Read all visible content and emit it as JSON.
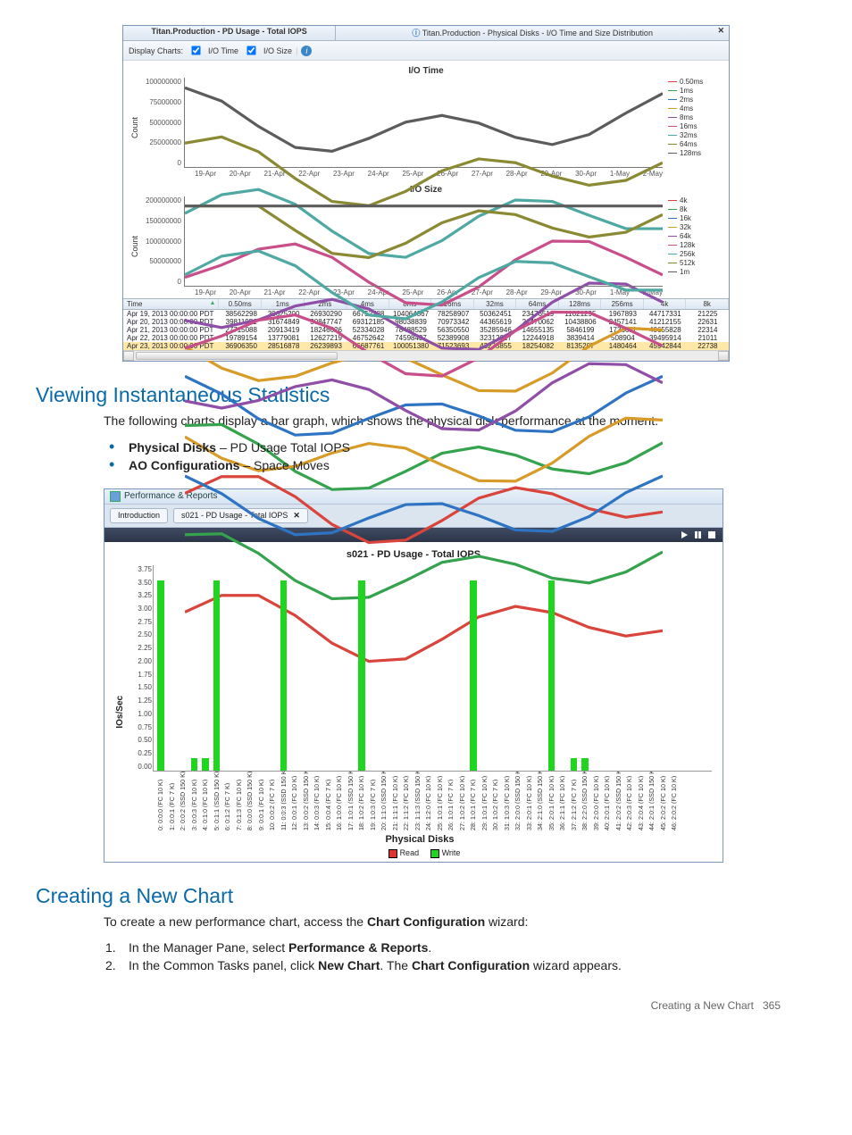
{
  "section1": {
    "heading": "Viewing Instantaneous Statistics",
    "intro": "The following charts display a bar graph, which shows the physical disk performance at the moment:",
    "bullets": [
      {
        "bold": "Physical Disks",
        "rest": " – PD Usage Total IOPS"
      },
      {
        "bold": "AO Configurations",
        "rest": " – Space Moves"
      }
    ]
  },
  "section2": {
    "heading": "Creating a New Chart",
    "intro_pre": "To create a new performance chart, access the ",
    "intro_bold": "Chart Configuration",
    "intro_post": " wizard:",
    "steps": [
      {
        "pre": "In the Manager Pane, select ",
        "b1": "Performance & Reports",
        "post1": ".",
        "b2": "",
        "post2": ""
      },
      {
        "pre": "In the Common Tasks panel, click ",
        "b1": "New Chart",
        "post1": ". The ",
        "b2": "Chart Configuration",
        "post2": " wizard appears."
      }
    ]
  },
  "app1": {
    "title_left": "Titan.Production - PD Usage - Total IOPS",
    "title_right": "Titan.Production - Physical Disks - I/O Time and Size Distribution",
    "toolbar": {
      "display_label": "Display Charts:",
      "iotime_label": "I/O Time",
      "iosize_label": "I/O Size",
      "info_icon": "i"
    },
    "chart1": {
      "title": "I/O Time",
      "ylabel": "Count"
    },
    "chart2": {
      "title": "I/O Size",
      "ylabel": "Count"
    },
    "x_dates": [
      "19-Apr",
      "20-Apr",
      "21-Apr",
      "22-Apr",
      "23-Apr",
      "24-Apr",
      "25-Apr",
      "26-Apr",
      "27-Apr",
      "28-Apr",
      "29-Apr",
      "30-Apr",
      "1-May",
      "2-May"
    ],
    "legend_time": [
      {
        "label": "0.50ms",
        "color": "#d9453c"
      },
      {
        "label": "1ms",
        "color": "#35a24d"
      },
      {
        "label": "2ms",
        "color": "#2f74c2"
      },
      {
        "label": "4ms",
        "color": "#d79b28"
      },
      {
        "label": "8ms",
        "color": "#8f4fa6"
      },
      {
        "label": "16ms",
        "color": "#c84f8a"
      },
      {
        "label": "32ms",
        "color": "#4fa8a2"
      },
      {
        "label": "64ms",
        "color": "#8a8a34"
      },
      {
        "label": "128ms",
        "color": "#5c5c5c"
      }
    ],
    "legend_size": [
      {
        "label": "4k",
        "color": "#d9453c"
      },
      {
        "label": "8k",
        "color": "#35a24d"
      },
      {
        "label": "16k",
        "color": "#2f74c2"
      },
      {
        "label": "32k",
        "color": "#d79b28"
      },
      {
        "label": "64k",
        "color": "#8f4fa6"
      },
      {
        "label": "128k",
        "color": "#c84f8a"
      },
      {
        "label": "256k",
        "color": "#4fa8a2"
      },
      {
        "label": "512k",
        "color": "#8a8a34"
      },
      {
        "label": "1m",
        "color": "#5c5c5c"
      }
    ],
    "chart1_yticks": [
      "100000000",
      "75000000",
      "50000000",
      "25000000",
      "0"
    ],
    "chart2_yticks": [
      "200000000",
      "150000000",
      "100000000",
      "50000000",
      "0"
    ],
    "table": {
      "headers": [
        "Time",
        "0.50ms",
        "1ms",
        "2ms",
        "4ms",
        "8ms",
        "16ms",
        "32ms",
        "64ms",
        "128ms",
        "256ms",
        "4k",
        "8k"
      ],
      "rows": [
        [
          "Apr 19, 2013 00:00:00 PDT",
          "38562298",
          "30625200",
          "26930290",
          "66752788",
          "104064367",
          "78258907",
          "50362451",
          "23476519",
          "11021295",
          "1967893",
          "44717331",
          "21225"
        ],
        [
          "Apr 20, 2013 00:00:00 PDT",
          "39811951",
          "31674849",
          "30847747",
          "69312185",
          "98038839",
          "70973342",
          "44365619",
          "21470062",
          "10438806",
          "2457141",
          "41212155",
          "22631"
        ],
        [
          "Apr 21, 2013 00:00:00 PDT",
          "27715088",
          "20913419",
          "18246626",
          "52334028",
          "78488529",
          "56350550",
          "35285946",
          "14655135",
          "5846199",
          "1736611",
          "40655828",
          "22314"
        ],
        [
          "Apr 22, 2013 00:00:00 PDT",
          "19789154",
          "13779081",
          "12627219",
          "46752642",
          "74598437",
          "52389908",
          "32312617",
          "12244918",
          "3839414",
          "508904",
          "39495914",
          "21011"
        ],
        [
          "Apr 23, 2013 00:00:00 PDT",
          "36906350",
          "28516878",
          "26239893",
          "66687761",
          "100051380",
          "71523693",
          "43235855",
          "18254082",
          "8135207",
          "1480464",
          "45942844",
          "22738"
        ]
      ],
      "selected_row_index": 4
    }
  },
  "app2": {
    "window_title": "Performance & Reports",
    "tabs": [
      {
        "label": "Introduction",
        "closable": false
      },
      {
        "label": "s021 - PD Usage - Total IOPS",
        "closable": true
      }
    ]
  },
  "chart_data": {
    "type": "bar",
    "title": "s021 - PD Usage - Total IOPS",
    "xlabel": "Physical Disks",
    "ylabel": "IOs/Sec",
    "ylim": [
      0,
      4
    ],
    "yticks": [
      "3.75",
      "3.50",
      "3.25",
      "3.00",
      "2.75",
      "2.50",
      "2.25",
      "2.00",
      "1.75",
      "1.50",
      "1.25",
      "1.00",
      "0.75",
      "0.50",
      "0.25",
      "0.00"
    ],
    "legend": [
      "Read",
      "Write"
    ],
    "categories": [
      "0: 0:0:0 (FC 10 K)",
      "1: 0:0:1 (FC 7 K)",
      "2: 0:0:2 (SSD 150 K)",
      "3: 0:0:3 (FC 10 K)",
      "4: 0:1:0 (FC 10 K)",
      "5: 0:1:1 (SSD 150 K)",
      "6: 0:1:2 (FC 7 K)",
      "7: 0:1:3 (FC 10 K)",
      "8: 0:0:0 (SSD 150 K)",
      "9: 0:0:1 (FC 10 K)",
      "10: 0:0:2 (FC 7 K)",
      "11: 0:0:3 (SSD 150 K)",
      "12: 0:0:1 (FC 10 K)",
      "13: 0:0:2 (SSD 150 K)",
      "14: 0:0:3 (FC 10 K)",
      "15: 0:0:4 (FC 7 K)",
      "16: 1:0:0 (FC 10 K)",
      "17: 1:0:1 (SSD 150 K)",
      "18: 1:0:2 (FC 10 K)",
      "19: 1:0:3 (FC 7 K)",
      "20: 1:1:0 (SSD 150 K)",
      "21: 1:1:1 (FC 10 K)",
      "22: 1:1:2 (FC 10 K)",
      "23: 1:1:3 (SSD 150 K)",
      "24: 1:2:0 (FC 10 K)",
      "25: 1:0:1 (FC 10 K)",
      "26: 1:0:1 (FC 7 K)",
      "27: 1:0:2 (FC 10 K)",
      "28: 1:0:1 (FC 7 K)",
      "29: 1:0:1 (FC 10 K)",
      "30: 1:0:2 (FC 7 K)",
      "31: 1:0:3 (FC 10 K)",
      "32: 2:0:0 (SSD 150 K)",
      "33: 2:0:1 (FC 10 K)",
      "34: 2:1:0 (SSD 150 K)",
      "35: 2:0:1 (FC 10 K)",
      "36: 2:1:1 (FC 10 K)",
      "37: 2:1:2 (FC 7 K)",
      "38: 2:2:0 (SSD 150 K)",
      "39: 2:0:0 (FC 10 K)",
      "40: 2:0:1 (FC 10 K)",
      "41: 2:0:2 (SSD 150 K)",
      "42: 2:0:3 (FC 10 K)",
      "43: 2:0:4 (FC 10 K)",
      "44: 2:0:1 (SSD 150 K)",
      "45: 2:0:2 (FC 10 K)",
      "46: 2:0:2 (FC 10 K)"
    ],
    "values": [
      3.7,
      0,
      0,
      0.25,
      0.25,
      3.7,
      0,
      0,
      0,
      0,
      0,
      3.7,
      0,
      0,
      0,
      0,
      0,
      0,
      3.7,
      0,
      0,
      0,
      0,
      0,
      0,
      0,
      0,
      0,
      3.7,
      0,
      0,
      0,
      0,
      0,
      0,
      3.7,
      0,
      0.25,
      0.25,
      0,
      0,
      0,
      0,
      0,
      0,
      0,
      0
    ]
  },
  "footer": {
    "text": "Creating a New Chart",
    "page": "365"
  }
}
